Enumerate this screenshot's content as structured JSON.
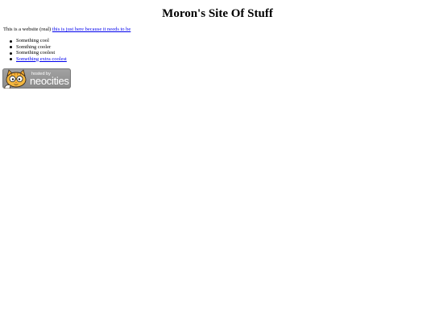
{
  "page": {
    "title": "Moron's Site Of Stuff",
    "intro_text": "This is a website (real) ",
    "intro_link": "this is just here because it needs to be"
  },
  "list": {
    "items": [
      "Something cool",
      "Somthing cooler",
      "Something coolest"
    ],
    "link_item": "Something extra coolest"
  },
  "badge": {
    "small_text": "hosted by",
    "brand_text": "neocities",
    "icon": "neocities-cat-icon"
  }
}
